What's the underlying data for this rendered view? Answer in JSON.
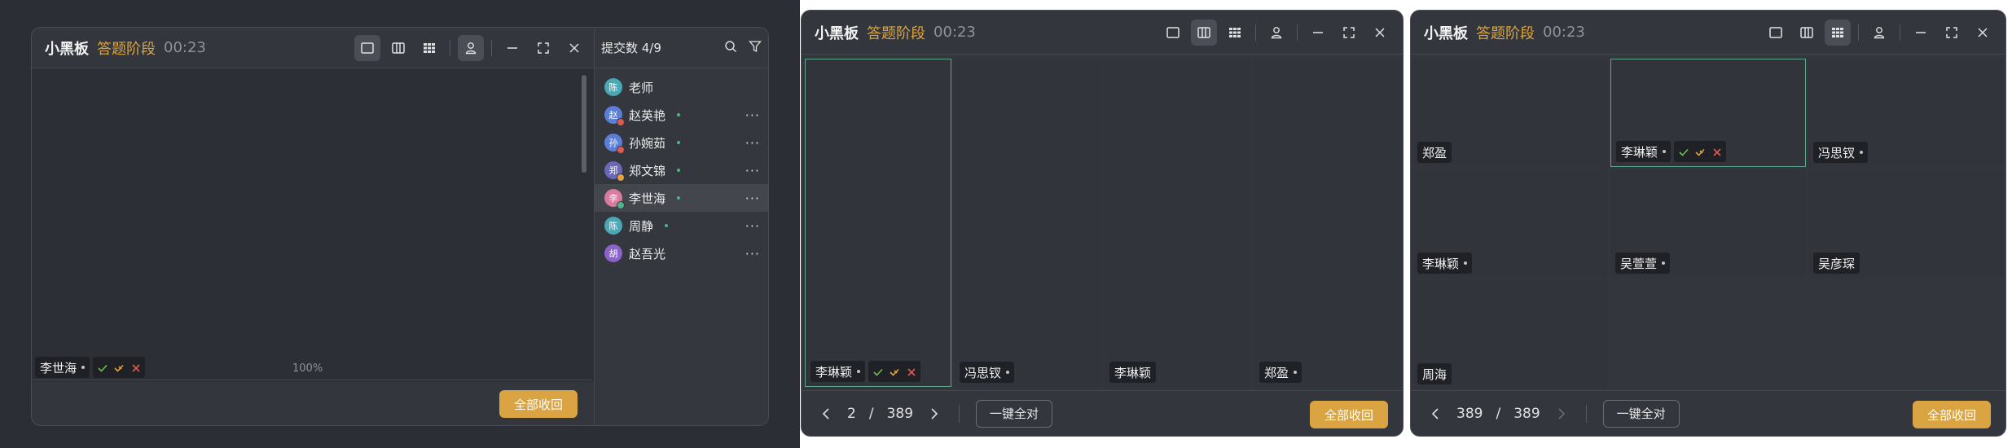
{
  "panels": [
    {
      "title": "小黑板",
      "stage": "答题阶段",
      "timer": "00:23",
      "canvas": {
        "zoom": "100%",
        "student": "李世海",
        "marks": [
          "check-icon",
          "half-check-icon",
          "cross-icon"
        ]
      },
      "sidebar": {
        "header": "提交数 4/9",
        "participants": [
          {
            "avatar": "陈",
            "name": "老师",
            "avatar_color": "#4aa8b5",
            "status": "",
            "online": false,
            "more": false
          },
          {
            "avatar": "赵",
            "name": "赵英艳",
            "avatar_color": "#5b7fd6",
            "status": "#e05a4f",
            "online": true,
            "more": true
          },
          {
            "avatar": "孙",
            "name": "孙婉茹",
            "avatar_color": "#5b7fd6",
            "status": "#e05a4f",
            "online": true,
            "more": true
          },
          {
            "avatar": "郑",
            "name": "郑文锦",
            "avatar_color": "#6a66b8",
            "status": "#e0a43c",
            "online": true,
            "more": true
          },
          {
            "avatar": "李",
            "name": "李世海",
            "avatar_color": "#d97b9e",
            "status": "#4fb38a",
            "online": true,
            "more": true,
            "highlight": true
          },
          {
            "avatar": "陈",
            "name": "周静",
            "avatar_color": "#4aa8b5",
            "status": "",
            "online": true,
            "more": true
          },
          {
            "avatar": "胡",
            "name": "赵吾光",
            "avatar_color": "#8a63c9",
            "status": "",
            "online": false,
            "more": true
          }
        ]
      },
      "collect_label": "全部收回"
    },
    {
      "title": "小黑板",
      "stage": "答题阶段",
      "timer": "00:23",
      "tiles": [
        {
          "name": "李琳颖",
          "dot": true,
          "marks": true
        },
        {
          "name": "冯思钗",
          "dot": true,
          "marks": false
        },
        {
          "name": "李琳颖",
          "dot": false,
          "marks": false
        },
        {
          "name": "郑盈",
          "dot": true,
          "marks": false
        }
      ],
      "pager": {
        "current": "2",
        "sep": "/",
        "total": "389"
      },
      "all_right_label": "一键全对",
      "collect_label": "全部收回"
    },
    {
      "title": "小黑板",
      "stage": "答题阶段",
      "timer": "00:23",
      "tiles": [
        {
          "name": "郑盈",
          "dot": false,
          "marks": false
        },
        {
          "name": "李琳颖",
          "dot": true,
          "marks": true
        },
        {
          "name": "冯思钗",
          "dot": true,
          "marks": false
        },
        {
          "name": "李琳颖",
          "dot": true,
          "marks": false
        },
        {
          "name": "吴萱萱",
          "dot": true,
          "marks": false
        },
        {
          "name": "吴彦琛",
          "dot": false,
          "marks": false
        },
        {
          "name": "周海",
          "dot": false,
          "marks": false
        }
      ],
      "pager": {
        "current": "389",
        "sep": "/",
        "total": "389"
      },
      "all_right_label": "一键全对",
      "collect_label": "全部收回"
    }
  ]
}
